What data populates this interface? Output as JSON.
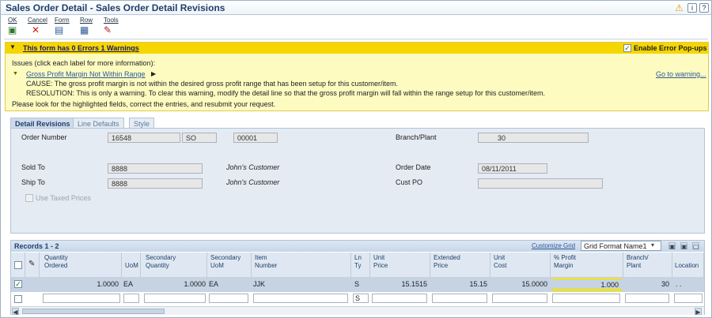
{
  "window": {
    "title": "Sales Order Detail - Sales Order Detail Revisions"
  },
  "toolbar": {
    "ok": "OK",
    "cancel": "Cancel",
    "form": "Form",
    "row": "Row",
    "tools": "Tools"
  },
  "warning": {
    "header": "This form has 0 Errors 1 Warnings",
    "enable_popups": "Enable Error Pop-ups",
    "issues": "Issues (click each label for more information):",
    "issue_title": "Gross Profit Margin Not Within Range",
    "goto": "Go to warning...",
    "cause": "CAUSE: The gross profit margin is not within the desired gross profit range that has been setup for this customer/item.",
    "resolution": "RESOLUTION: This is only a warning. To clear this warning, modify the detail line so that the gross profit margin will fall within the range setup for this customer/item.",
    "footer": "Please look for the highlighted fields, correct the entries, and resubmit your request."
  },
  "tabs": [
    "Detail Revisions",
    "Line Defaults",
    "Style"
  ],
  "form": {
    "order_number_label": "Order Number",
    "order_number": "16548",
    "order_type": "SO",
    "order_company": "00001",
    "branch_label": "Branch/Plant",
    "branch": "30",
    "sold_to_label": "Sold To",
    "sold_to": "8888",
    "sold_to_name": "John's Customer",
    "order_date_label": "Order Date",
    "order_date": "08/11/2011",
    "ship_to_label": "Ship To",
    "ship_to": "8888",
    "ship_to_name": "John's Customer",
    "cust_po_label": "Cust PO",
    "cust_po": "",
    "use_taxed_prices": "Use Taxed Prices"
  },
  "grid": {
    "records": "Records 1 - 2",
    "customize": "Customize Grid",
    "format": "Grid Format Name1",
    "headers": {
      "qty": [
        "Quantity",
        "Ordered"
      ],
      "uom": [
        "",
        "UoM"
      ],
      "sec_qty": [
        "Secondary",
        "Quantity"
      ],
      "sec_uom": [
        "Secondary",
        "UoM"
      ],
      "item": [
        "Item",
        "Number"
      ],
      "lnty": [
        "Ln",
        "Ty"
      ],
      "unit_price": [
        "Unit",
        "Price"
      ],
      "ext_price": [
        "Extended",
        "Price"
      ],
      "unit_cost": [
        "Unit",
        "Cost"
      ],
      "profit": [
        "% Profit",
        "Margin"
      ],
      "branch": [
        "Branch/",
        "Plant"
      ],
      "location": [
        "",
        "Location"
      ]
    },
    "row": {
      "qty": "1.0000",
      "uom": "EA",
      "sec_qty": "1.0000",
      "sec_uom": "EA",
      "item": "JJK",
      "lnty": "S",
      "unit_price": "15.1515",
      "ext_price": "15.15",
      "unit_cost": "15.0000",
      "profit": "1.000",
      "branch": "30",
      "location": ". ."
    },
    "new_row": {
      "lnty": "S"
    }
  },
  "colors": {
    "warning_bar": "#f5d600",
    "warning_bg": "#fdfbc0",
    "panel": "#e4ebf3",
    "highlight": "#f5e400"
  }
}
